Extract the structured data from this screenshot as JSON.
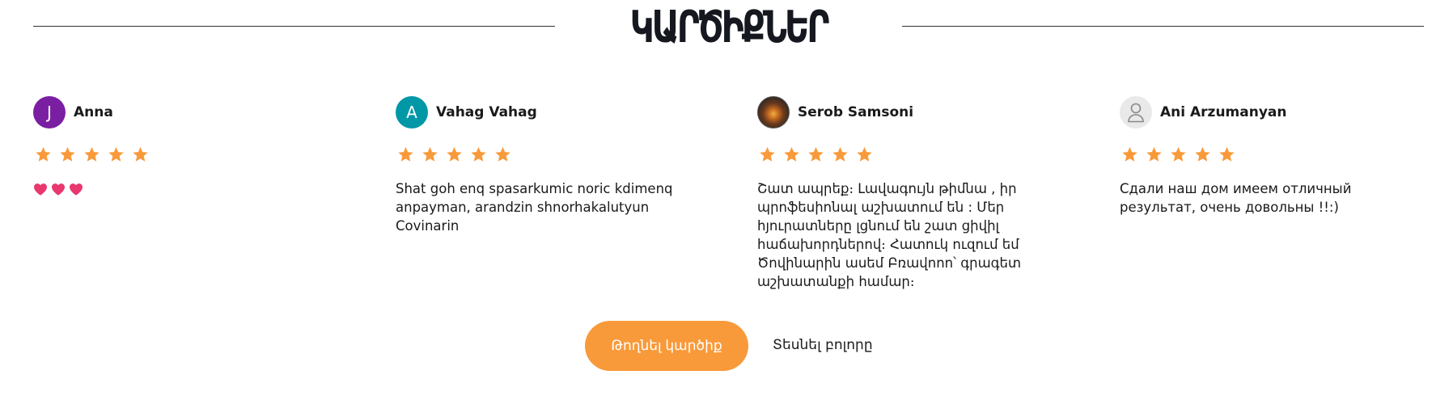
{
  "section": {
    "title": "ԿԱՐԾԻՔՆԵՐ"
  },
  "colors": {
    "accent": "#f99a3a",
    "star": "#f99a3a",
    "heart": "#e8386e",
    "avatar_purple": "#7b1fa2",
    "avatar_teal": "#0097a7"
  },
  "reviews": [
    {
      "name": "Anna",
      "avatar_letter": "J",
      "avatar_type": "letter",
      "rating": 5,
      "text": "",
      "hearts_emoji": "heart-emoji x3"
    },
    {
      "name": "Vahag Vahag",
      "avatar_letter": "A",
      "avatar_type": "letter",
      "rating": 5,
      "text": "Shat goh enq spasarkumic noric kdimenq anpayman, arandzin shnorhakalutyun Covinarin"
    },
    {
      "name": "Serob Samsoni",
      "avatar_type": "photo",
      "rating": 5,
      "text": "Շատ ապրեք։ Լավագույն թիմնա , իր պրոֆեսիոնալ աշխատում են : Մեր հյուրատները լցնում են շատ ցիվիլ հաճախորդներով։ Հատուկ ուզում եմ Ծովինարին ասեմ Բռավոոո՝ գրագետ աշխատանքի համար։"
    },
    {
      "name": "Ani Arzumanyan",
      "avatar_type": "generic-user",
      "rating": 5,
      "text": "Сдали наш дом имеем отличный результат, очень довольны !!:)"
    }
  ],
  "actions": {
    "leave_review_label": "Թողնել կարծիք",
    "see_all_label": "Տեսնել բոլորը"
  }
}
